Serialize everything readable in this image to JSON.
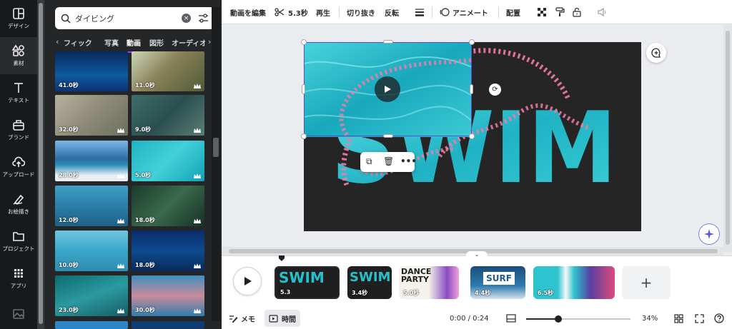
{
  "rail": {
    "items": [
      {
        "label": "デザイン",
        "icon": "layout-icon"
      },
      {
        "label": "素材",
        "icon": "shapes-icon"
      },
      {
        "label": "テキスト",
        "icon": "text-icon"
      },
      {
        "label": "ブランド",
        "icon": "briefcase-icon"
      },
      {
        "label": "アップロード",
        "icon": "upload-cloud-icon"
      },
      {
        "label": "お絵描き",
        "icon": "pen-icon"
      },
      {
        "label": "プロジェクト",
        "icon": "folder-icon"
      },
      {
        "label": "アプリ",
        "icon": "grid-icon"
      }
    ]
  },
  "search": {
    "value": "ダイビング"
  },
  "tabs": {
    "items": [
      "フィック",
      "写真",
      "動画",
      "図形",
      "オーディオ"
    ],
    "active": "動画"
  },
  "results": {
    "durations": [
      "41.0秒",
      "11.0秒",
      "32.0秒",
      "9.0秒",
      "28.0秒",
      "5.0秒",
      "12.0秒",
      "18.0秒",
      "10.0秒",
      "18.0秒",
      "23.0秒",
      "30.0秒"
    ]
  },
  "toolbar": {
    "edit_video": "動画を編集",
    "trim_duration": "5.3秒",
    "playback": "再生",
    "crop": "切り抜き",
    "flip": "反転",
    "animate": "アニメート",
    "position": "配置"
  },
  "canvas": {
    "headline": "SWIM"
  },
  "timeline": {
    "clips": [
      {
        "duration": "5.3",
        "label": "SWIM"
      },
      {
        "duration": "3.4秒",
        "label": "SWIM"
      },
      {
        "duration": "5.0秒",
        "label": "DANCE PARTY"
      },
      {
        "duration": "4.4秒",
        "label": "SURF"
      },
      {
        "duration": "6.5秒",
        "label": ""
      }
    ],
    "memo": "メモ",
    "time_toggle": "時間",
    "time_readout": "0:00 / 0:24",
    "zoom": "34%",
    "zoom_value": 0.31
  },
  "colors": {
    "accent": "#8b3dff",
    "selection": "#5c4ad6",
    "water": "#2fc4cf",
    "pink_strokes": "#f27ba7"
  }
}
